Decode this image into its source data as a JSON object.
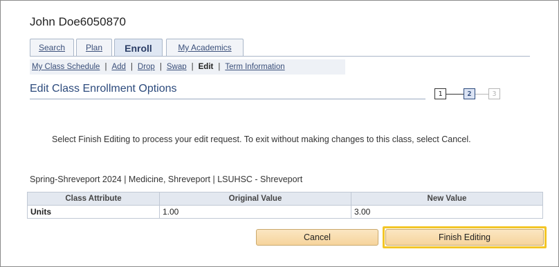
{
  "user": {
    "name": "John Doe6050870"
  },
  "tabs": [
    {
      "label": "Search",
      "active": false
    },
    {
      "label": "Plan",
      "active": false
    },
    {
      "label": "Enroll",
      "active": true
    },
    {
      "label": "My Academics",
      "active": false
    }
  ],
  "subnav": {
    "items": [
      "My Class Schedule",
      "Add",
      "Drop",
      "Swap",
      "Edit",
      "Term Information"
    ],
    "current": "Edit",
    "separator": "|"
  },
  "page": {
    "title": "Edit Class Enrollment Options"
  },
  "steps": {
    "labels": [
      "1",
      "2",
      "3"
    ],
    "current": 2
  },
  "instructions": "Select Finish Editing to process your edit request.  To exit without making changes to this class, select Cancel.",
  "term_line": "Spring-Shreveport 2024 | Medicine, Shreveport | LSUHSC - Shreveport",
  "table": {
    "headers": [
      "Class Attribute",
      "Original Value",
      "New Value"
    ],
    "rows": [
      [
        "Units",
        "1.00",
        "3.00"
      ]
    ]
  },
  "buttons": {
    "cancel": "Cancel",
    "finish": "Finish Editing"
  },
  "colors": {
    "accent": "#2c4a7c",
    "button": "#f6d49c",
    "highlight": "#f3c526"
  }
}
